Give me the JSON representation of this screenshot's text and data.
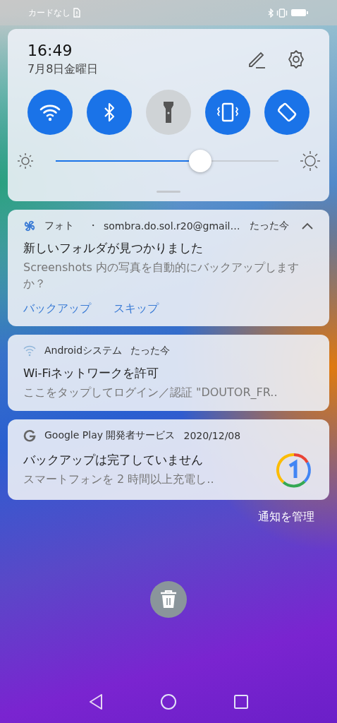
{
  "status_bar": {
    "carrier": "カードなし"
  },
  "quick_panel": {
    "time": "16:49",
    "date": "7月8日金曜日",
    "toggles": [
      {
        "kind": "wifi",
        "on": true
      },
      {
        "kind": "bluetooth",
        "on": true
      },
      {
        "kind": "flashlight",
        "on": false
      },
      {
        "kind": "vibrate",
        "on": true
      },
      {
        "kind": "rotate",
        "on": true
      }
    ],
    "brightness": {
      "level": 0.65
    }
  },
  "notifications": [
    {
      "kind": "photos",
      "app": "フォト",
      "separator": "・",
      "account": "sombra.do.sol.r20@gmail…",
      "time": "たった今",
      "expanded": true,
      "title": "新しいフォルダが見つかりました",
      "text": "Screenshots 内の写真を自動的にバックアップしますか？",
      "actions": [
        "バックアップ",
        "スキップ"
      ]
    },
    {
      "kind": "system",
      "app": "Androidシステム",
      "time": "たった今",
      "title": "Wi-Fiネットワークを許可",
      "text": "ここをタップしてログイン／認証 \"DOUTOR_FR.."
    },
    {
      "kind": "play",
      "app": "Google Play 開発者サービス",
      "time": "2020/12/08",
      "title": "バックアップは完了していません",
      "text": "スマートフォンを 2 時間以上充電し..",
      "large_icon": true
    }
  ],
  "manage_link": "通知を管理"
}
